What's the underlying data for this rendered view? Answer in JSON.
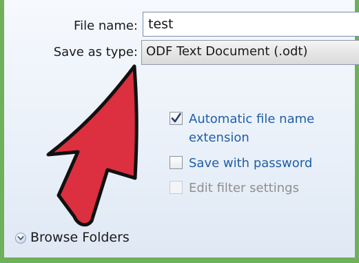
{
  "file_name": {
    "label": "File name:",
    "value": "test"
  },
  "save_as_type": {
    "label": "Save as type:",
    "selected": "ODF Text Document (.odt)"
  },
  "options": {
    "auto_extension": {
      "label_line1": "Automatic file name",
      "label_line2": "extension",
      "checked": true
    },
    "save_with_password": {
      "label": "Save with password",
      "checked": false
    },
    "edit_filter_settings": {
      "label": "Edit filter settings",
      "checked": false,
      "enabled": false
    }
  },
  "browse_folders": {
    "label": "Browse Folders",
    "icon": "chevron-down-icon"
  },
  "colors": {
    "link_blue": "#1e5ea8",
    "arrow_red": "#dc2f3f",
    "frame_green": "#6fb05a"
  }
}
